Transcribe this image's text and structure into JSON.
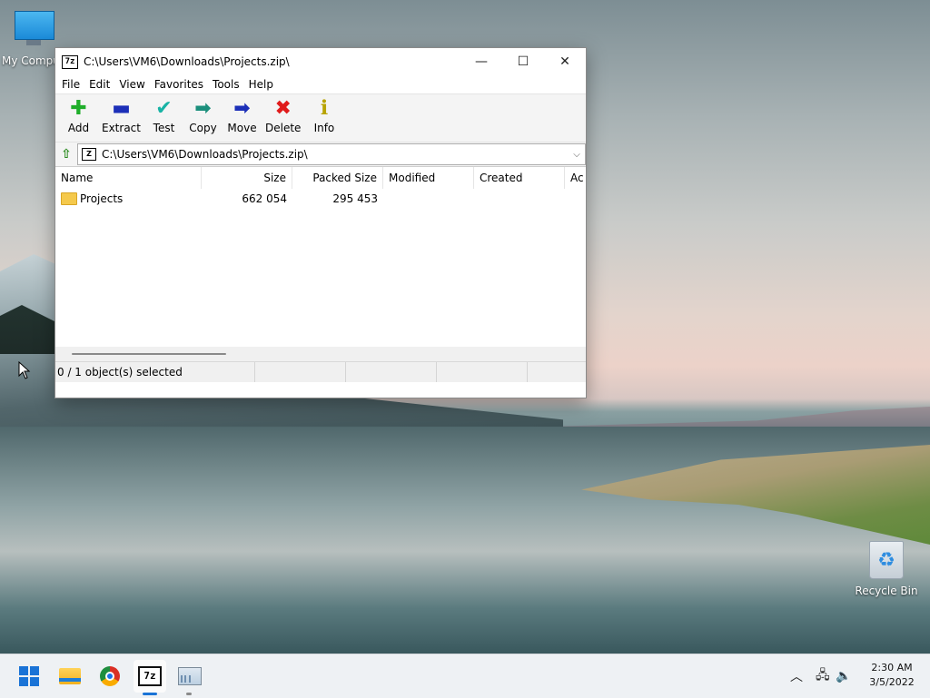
{
  "desktop": {
    "icons": {
      "my_computer": "My Computer",
      "recycle_bin": "Recycle Bin"
    }
  },
  "window": {
    "title": "C:\\Users\\VM6\\Downloads\\Projects.zip\\",
    "app_icon_text": "7z",
    "controls": {
      "minimize": "—",
      "maximize": "☐",
      "close": "✕"
    },
    "menu": [
      "File",
      "Edit",
      "View",
      "Favorites",
      "Tools",
      "Help"
    ],
    "toolbar": [
      {
        "label": "Add",
        "icon": "plus-icon",
        "glyph": "✚",
        "color": "#1fae2a"
      },
      {
        "label": "Extract",
        "icon": "minus-icon",
        "glyph": "▬",
        "color": "#1c2fb8"
      },
      {
        "label": "Test",
        "icon": "checkmark-icon",
        "glyph": "✔",
        "color": "#18b3a5"
      },
      {
        "label": "Copy",
        "icon": "double-arrow-icon",
        "glyph": "➡",
        "color": "#1b8f7c"
      },
      {
        "label": "Move",
        "icon": "arrow-right-icon",
        "glyph": "➡",
        "color": "#1c2fb8"
      },
      {
        "label": "Delete",
        "icon": "x-icon",
        "glyph": "✖",
        "color": "#e01b1b"
      },
      {
        "label": "Info",
        "icon": "info-icon",
        "glyph": "ℹ",
        "color": "#b7a300"
      }
    ],
    "address": {
      "value": "C:\\Users\\VM6\\Downloads\\Projects.zip\\",
      "icon_text": "Z"
    },
    "columns": {
      "name": "Name",
      "size": "Size",
      "packed": "Packed Size",
      "modified": "Modified",
      "created": "Created",
      "accessed": "Ac"
    },
    "rows": [
      {
        "name": "Projects",
        "size": "662 054",
        "packed": "295 453",
        "modified": "",
        "created": ""
      }
    ],
    "status": "0 / 1 object(s) selected"
  },
  "taskbar": {
    "clock_time": "2:30 AM",
    "clock_date": "3/5/2022",
    "sevenzip_text": "7z",
    "accent": "#1a73d6"
  }
}
